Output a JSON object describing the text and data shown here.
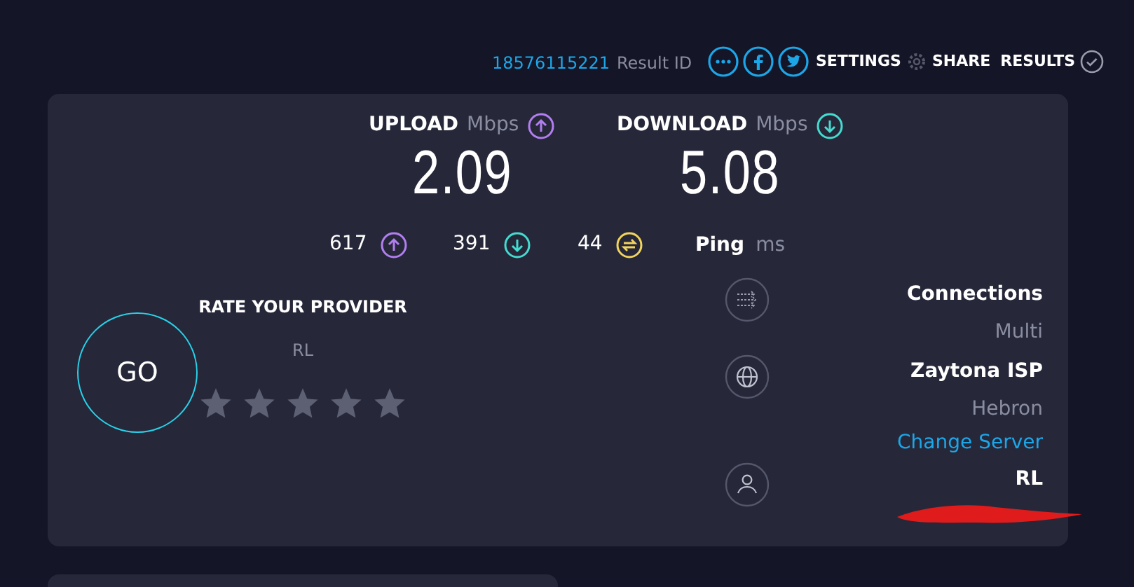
{
  "header": {
    "result_id": "18576115221",
    "result_id_label": "Result ID",
    "settings": "SETTINGS",
    "share": "SHARE",
    "results": "RESULTS"
  },
  "speeds": [
    {
      "kind": "upload",
      "label": "UPLOAD",
      "unit": "Mbps",
      "value": "2.09"
    },
    {
      "kind": "download",
      "label": "DOWNLOAD",
      "unit": "Mbps",
      "value": "5.08"
    }
  ],
  "stats": [
    {
      "kind": "upload",
      "value": "617"
    },
    {
      "kind": "download",
      "value": "391"
    },
    {
      "kind": "jitter",
      "value": "44"
    }
  ],
  "ping": {
    "label": "Ping",
    "unit": "ms"
  },
  "go_button": "GO",
  "rating": {
    "title": "RATE YOUR PROVIDER",
    "provider": "RL",
    "stars": 0
  },
  "info": [
    {
      "kind": "connections",
      "title": "Connections",
      "value": "Multi"
    },
    {
      "kind": "server",
      "title": "Zaytona ISP",
      "value": "Hebron",
      "link": "Change Server"
    },
    {
      "kind": "user",
      "title": "RL",
      "redacted": true
    }
  ]
}
